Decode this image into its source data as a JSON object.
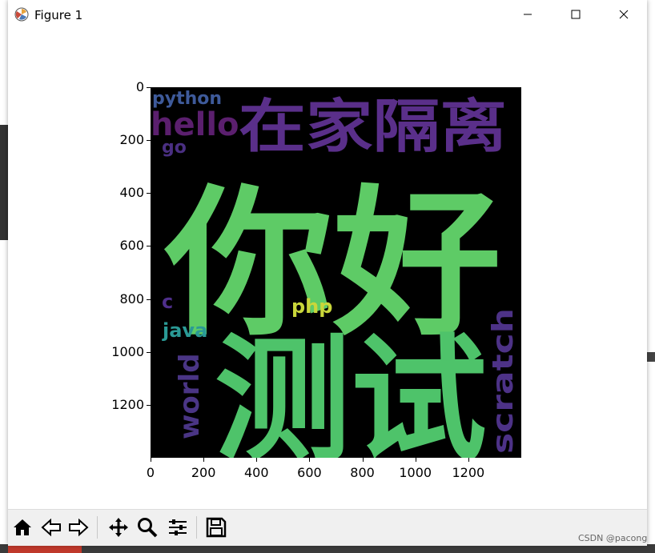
{
  "window": {
    "title": "Figure 1",
    "icons": [
      "figure-app-icon",
      "minimize-icon",
      "maximize-icon",
      "close-icon"
    ]
  },
  "plot": {
    "type": "image-wordcloud",
    "y_ticks": [
      "0",
      "200",
      "400",
      "600",
      "800",
      "1000",
      "1200"
    ],
    "x_ticks": [
      "0",
      "200",
      "400",
      "600",
      "800",
      "1000",
      "1200"
    ],
    "xlim": [
      0,
      1400
    ],
    "ylim": [
      1400,
      0
    ],
    "words": [
      {
        "text": "你好",
        "color": "#5ecb66"
      },
      {
        "text": "测试",
        "color": "#4ec36a"
      },
      {
        "text": "在家隔离",
        "color": "#5a2f8a"
      },
      {
        "text": "python",
        "color": "#3e5a9a"
      },
      {
        "text": "hello",
        "color": "#5b1f6e"
      },
      {
        "text": "go",
        "color": "#4a2f82"
      },
      {
        "text": "c",
        "color": "#4f2f8c"
      },
      {
        "text": "php",
        "color": "#c9d63a"
      },
      {
        "text": "java",
        "color": "#2a9a96"
      },
      {
        "text": "world",
        "color": "#4a3585"
      },
      {
        "text": "scratch",
        "color": "#4d3287"
      }
    ]
  },
  "toolbar": {
    "buttons": [
      "home-icon",
      "back-icon",
      "forward-icon",
      "pan-icon",
      "zoom-icon",
      "configure-subplots-icon",
      "save-icon"
    ]
  },
  "watermark": "CSDN @pacong"
}
